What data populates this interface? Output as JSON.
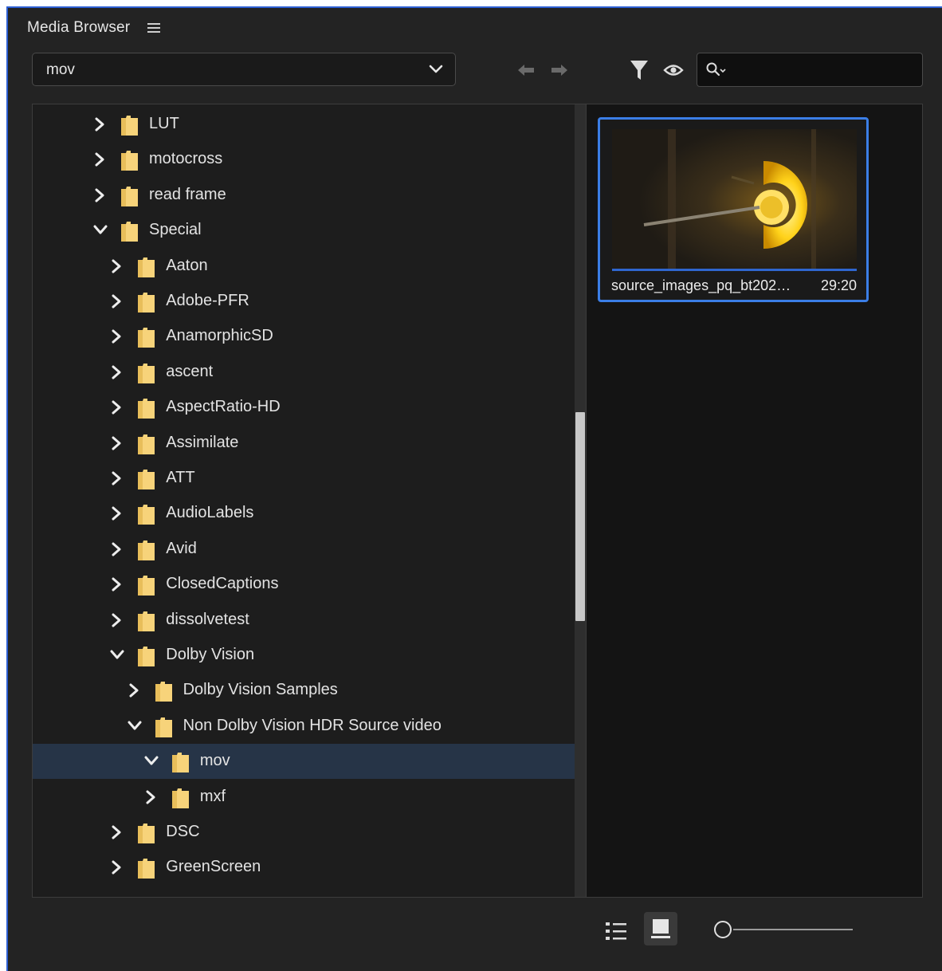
{
  "panel": {
    "title": "Media Browser"
  },
  "toolbar": {
    "path_value": "mov",
    "search_value": ""
  },
  "tree": [
    {
      "label": "LUT",
      "depth": 0,
      "expanded": false,
      "selected": false
    },
    {
      "label": "motocross",
      "depth": 0,
      "expanded": false,
      "selected": false
    },
    {
      "label": "read frame",
      "depth": 0,
      "expanded": false,
      "selected": false
    },
    {
      "label": "Special",
      "depth": 0,
      "expanded": true,
      "selected": false
    },
    {
      "label": "Aaton",
      "depth": 1,
      "expanded": false,
      "selected": false
    },
    {
      "label": "Adobe-PFR",
      "depth": 1,
      "expanded": false,
      "selected": false
    },
    {
      "label": "AnamorphicSD",
      "depth": 1,
      "expanded": false,
      "selected": false
    },
    {
      "label": "ascent",
      "depth": 1,
      "expanded": false,
      "selected": false
    },
    {
      "label": "AspectRatio-HD",
      "depth": 1,
      "expanded": false,
      "selected": false
    },
    {
      "label": "Assimilate",
      "depth": 1,
      "expanded": false,
      "selected": false
    },
    {
      "label": "ATT",
      "depth": 1,
      "expanded": false,
      "selected": false
    },
    {
      "label": "AudioLabels",
      "depth": 1,
      "expanded": false,
      "selected": false
    },
    {
      "label": "Avid",
      "depth": 1,
      "expanded": false,
      "selected": false
    },
    {
      "label": "ClosedCaptions",
      "depth": 1,
      "expanded": false,
      "selected": false
    },
    {
      "label": "dissolvetest",
      "depth": 1,
      "expanded": false,
      "selected": false
    },
    {
      "label": "Dolby Vision",
      "depth": 1,
      "expanded": true,
      "selected": false
    },
    {
      "label": "Dolby Vision Samples",
      "depth": 2,
      "expanded": false,
      "selected": false
    },
    {
      "label": "Non Dolby Vision HDR Source video",
      "depth": 2,
      "expanded": true,
      "selected": false
    },
    {
      "label": "mov",
      "depth": 3,
      "expanded": true,
      "selected": true
    },
    {
      "label": "mxf",
      "depth": 3,
      "expanded": false,
      "selected": false
    },
    {
      "label": "DSC",
      "depth": 1,
      "expanded": false,
      "selected": false
    },
    {
      "label": "GreenScreen",
      "depth": 1,
      "expanded": false,
      "selected": false
    }
  ],
  "preview": {
    "items": [
      {
        "name": "source_images_pq_bt202…",
        "duration": "29:20",
        "selected": true
      }
    ]
  },
  "footer": {
    "zoom_level": 0
  },
  "colors": {
    "accent": "#3b7ee6",
    "selection": "#263447",
    "folder": "#f7d37a"
  }
}
